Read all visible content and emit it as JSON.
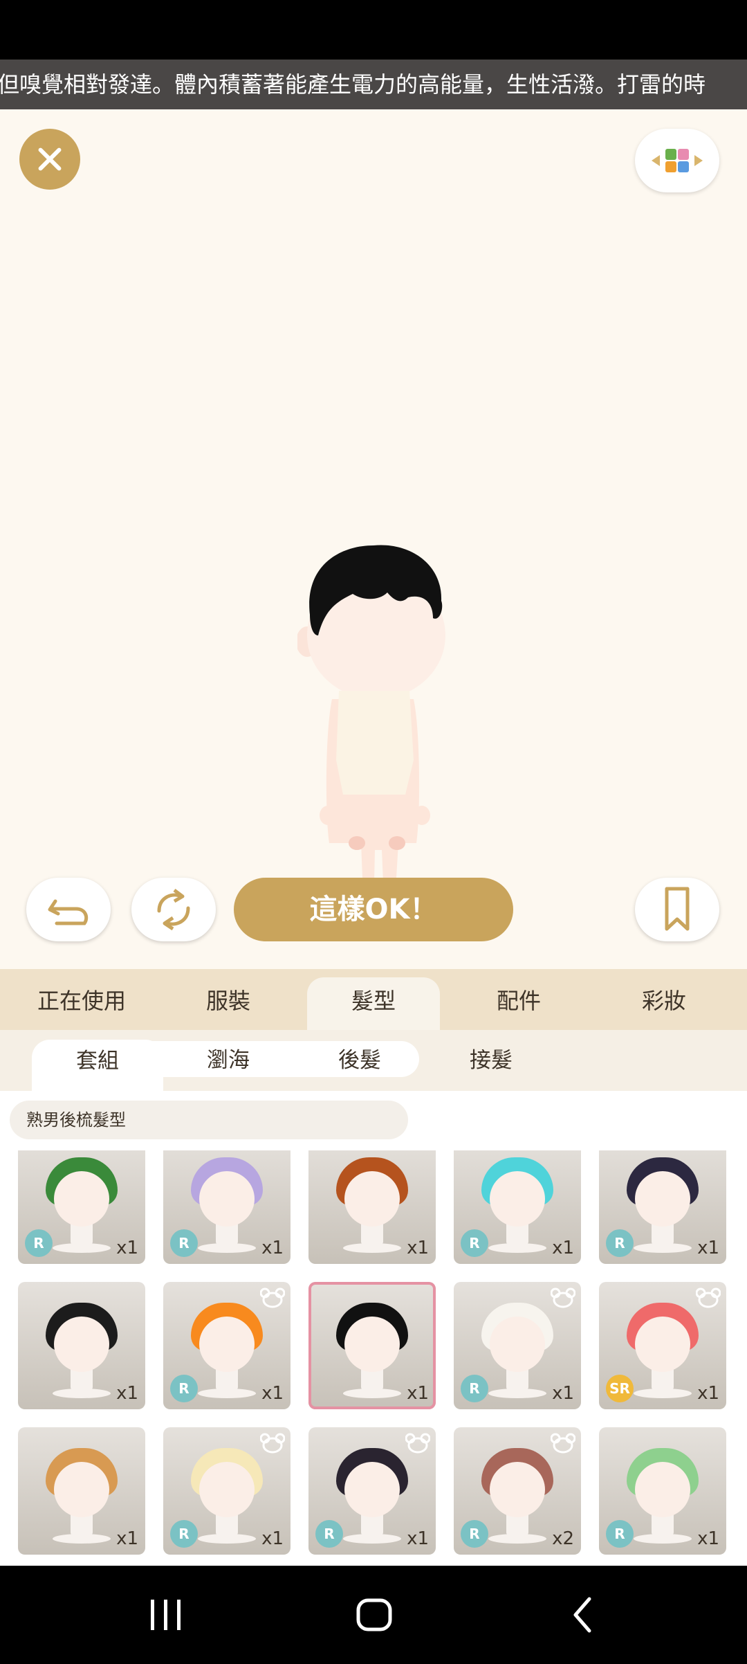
{
  "marquee": {
    "text": "但嗅覺相對發達。體內積蓄著能產生電力的高能量，生性活潑。打雷的時"
  },
  "stage": {
    "ok_label": "這樣OK！"
  },
  "tabs": [
    {
      "label": "正在使用"
    },
    {
      "label": "服裝"
    },
    {
      "label": "髮型"
    },
    {
      "label": "配件"
    },
    {
      "label": "彩妝"
    }
  ],
  "subtabs": [
    {
      "label": "套組"
    },
    {
      "label": "瀏海"
    },
    {
      "label": "後髮"
    },
    {
      "label": "接髮"
    }
  ],
  "search": {
    "label": "熟男後梳髮型"
  },
  "items": [
    {
      "qty": "x1",
      "rarity": "R",
      "hair": "#3a8a3a",
      "bear": false
    },
    {
      "qty": "x1",
      "rarity": "R",
      "hair": "#b7a6e0",
      "bear": false
    },
    {
      "qty": "x1",
      "rarity": "",
      "hair": "#b5531e",
      "bear": false
    },
    {
      "qty": "x1",
      "rarity": "R",
      "hair": "#4fd3da",
      "bear": false
    },
    {
      "qty": "x1",
      "rarity": "R",
      "hair": "#2c2840",
      "bear": false
    },
    {
      "qty": "x1",
      "rarity": "",
      "hair": "#1c1c1c",
      "bear": false
    },
    {
      "qty": "x1",
      "rarity": "R",
      "hair": "#f88a1e",
      "bear": true
    },
    {
      "qty": "x1",
      "rarity": "",
      "hair": "#111111",
      "bear": false,
      "selected": true
    },
    {
      "qty": "x1",
      "rarity": "R",
      "hair": "#f7f4ee",
      "bear": true
    },
    {
      "qty": "x1",
      "rarity": "SR",
      "hair": "#ef6a6a",
      "bear": true
    },
    {
      "qty": "x1",
      "rarity": "",
      "hair": "#d89a52",
      "bear": false
    },
    {
      "qty": "x1",
      "rarity": "R",
      "hair": "#f6e8b8",
      "bear": true
    },
    {
      "qty": "x1",
      "rarity": "R",
      "hair": "#2a2430",
      "bear": true
    },
    {
      "qty": "x2",
      "rarity": "R",
      "hair": "#a8675a",
      "bear": true
    },
    {
      "qty": "x1",
      "rarity": "R",
      "hair": "#8ed08e",
      "bear": false
    },
    {
      "qty": "",
      "rarity": "",
      "hair": "#e9e7e4",
      "bear": false
    },
    {
      "qty": "",
      "rarity": "",
      "hair": "#f1e2d4",
      "bear": false
    },
    {
      "qty": "",
      "rarity": "",
      "hair": "#f0dfd2",
      "bear": false
    },
    {
      "qty": "",
      "rarity": "",
      "hair": "#7a3a2e",
      "bear": false
    },
    {
      "qty": "",
      "rarity": "",
      "hair": "#7a3bbf",
      "bear": false
    }
  ]
}
